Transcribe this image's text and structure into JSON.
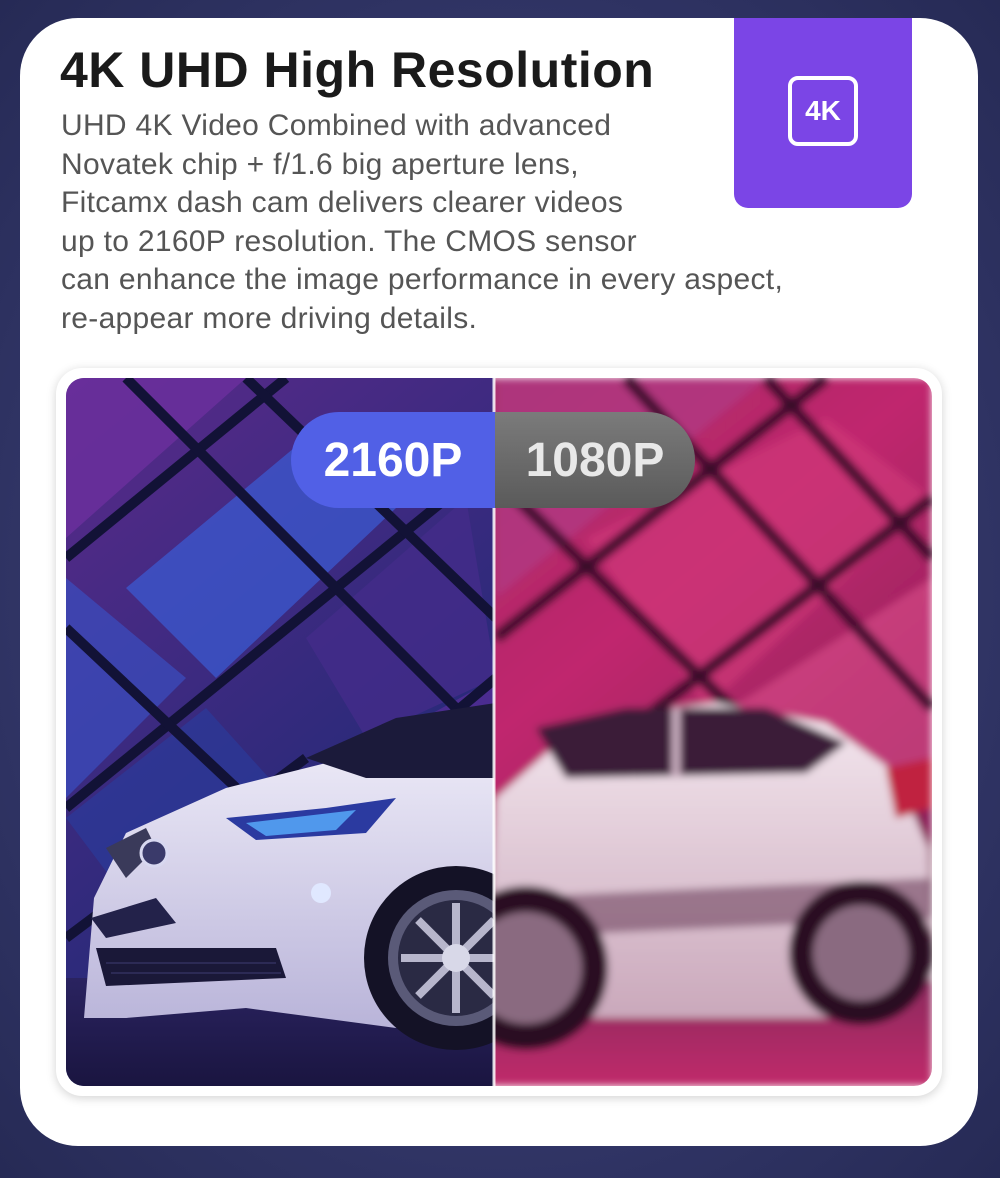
{
  "header": {
    "title": "4K UHD High Resolution",
    "description_lines": [
      "UHD 4K Video Combined with advanced",
      "Novatek chip + f/1.6 big aperture lens,",
      "Fitcamx dash cam delivers clearer videos",
      "up to 2160P resolution. The CMOS sensor",
      "can enhance the image performance in every aspect,",
      "re-appear more driving details."
    ]
  },
  "badge": {
    "label": "4K",
    "color": "#7b45e6"
  },
  "comparison": {
    "left_label": "2160P",
    "right_label": "1080P",
    "left_color": "#5160e6",
    "right_color": "#6a6a6a"
  }
}
